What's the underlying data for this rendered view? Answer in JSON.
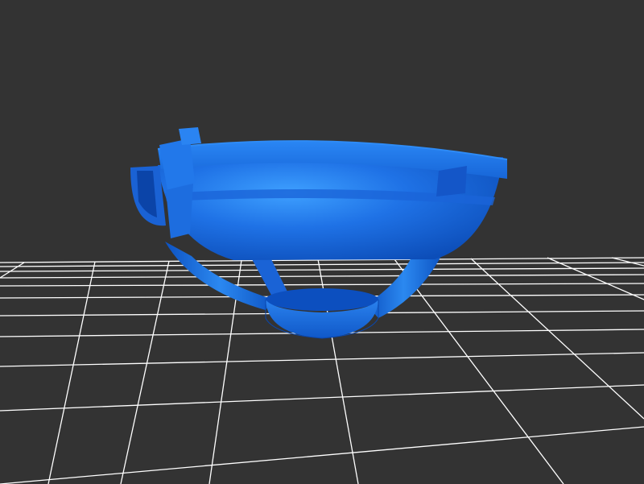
{
  "viewer": {
    "background_color": "#333333",
    "grid_color": "#ffffff",
    "model_color": "#1f6fe0",
    "model_highlight_color": "#3b9bff",
    "model_shadow_color": "#0b3f9a",
    "model": "blue-3d-printed-cup-shaped-part"
  }
}
